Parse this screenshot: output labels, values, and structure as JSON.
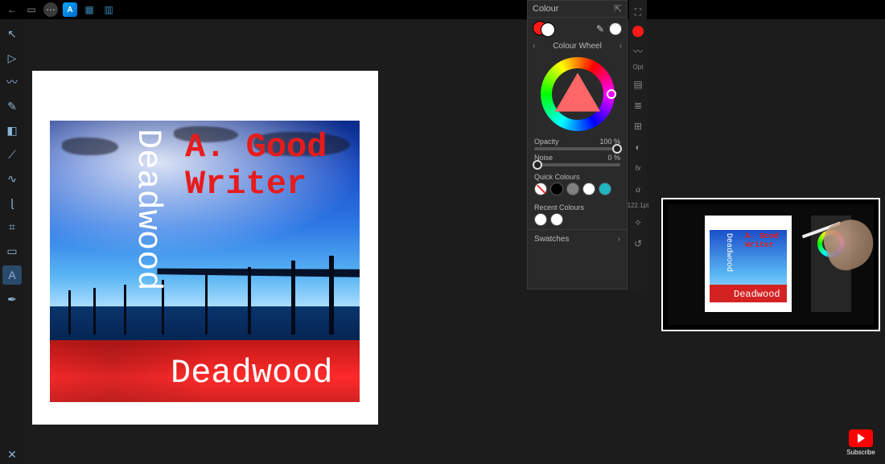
{
  "topbar": {
    "back": "←",
    "document": "▭",
    "more": "⋯",
    "logo": "A",
    "grid": "▦",
    "personas": "▥"
  },
  "toolbar": {
    "items": [
      {
        "name": "move-tool",
        "glyph": "↖"
      },
      {
        "name": "node-tool",
        "glyph": "▷"
      },
      {
        "name": "paint-brush-tool",
        "glyph": "〰"
      },
      {
        "name": "pencil-tool",
        "glyph": "✎"
      },
      {
        "name": "fill-tool",
        "glyph": "◧"
      },
      {
        "name": "eyedropper-tool",
        "glyph": "⟋"
      },
      {
        "name": "smudge-tool",
        "glyph": "∿"
      },
      {
        "name": "vector-brush-tool",
        "glyph": "ɭ"
      },
      {
        "name": "crop-tool",
        "glyph": "⌗"
      },
      {
        "name": "shape-tool",
        "glyph": "▭"
      },
      {
        "name": "artistic-text-tool",
        "glyph": "A",
        "selected": true
      },
      {
        "name": "pen-tool",
        "glyph": "✒"
      }
    ],
    "close": "✕"
  },
  "artwork": {
    "author_line1": "A. Good",
    "author_line2": "Writer",
    "title": "Deadwood",
    "title_vertical": "Deadwood"
  },
  "colour_panel": {
    "title": "Colour",
    "mode": "Colour Wheel",
    "opacity_label": "Opacity",
    "opacity_value": "100 %",
    "noise_label": "Noise",
    "noise_value": "0 %",
    "quick_label": "Quick Colours",
    "recent_label": "Recent Colours",
    "swatches_label": "Swatches",
    "fill": "#ff1a1a",
    "stroke": "#ffffff",
    "quick": [
      {
        "kind": "none"
      },
      {
        "hex": "#000000"
      },
      {
        "hex": "#808080"
      },
      {
        "hex": "#ffffff"
      },
      {
        "hex": "#1fb6c1"
      }
    ],
    "recent": [
      {
        "hex": "#ffffff"
      },
      {
        "hex": "#ffffff"
      }
    ]
  },
  "studio": {
    "items": [
      {
        "name": "expand-icon",
        "glyph": "⛶"
      },
      {
        "name": "active-colour-dot"
      },
      {
        "name": "brush-icon",
        "glyph": "〰"
      },
      {
        "name": "opt-label",
        "text": "Opt"
      },
      {
        "name": "layers-icon",
        "glyph": "▤"
      },
      {
        "name": "stack-icon",
        "glyph": "≣"
      },
      {
        "name": "grid-icon",
        "glyph": "⊞"
      },
      {
        "name": "adjust-icon",
        "glyph": "◐"
      },
      {
        "name": "fx-icon",
        "glyph": "fx"
      },
      {
        "name": "italic-a-icon",
        "glyph": "a"
      },
      {
        "name": "font-size",
        "text": "122.1pt"
      },
      {
        "name": "transform-icon",
        "glyph": "✧"
      },
      {
        "name": "history-icon",
        "glyph": "↺"
      }
    ]
  },
  "pip": {
    "author_line1": "A. Good",
    "author_line2": "Writer",
    "title": "Deadwood",
    "title_v": "Deadwood"
  },
  "subscribe": {
    "label": "Subscribe"
  },
  "signature": ""
}
